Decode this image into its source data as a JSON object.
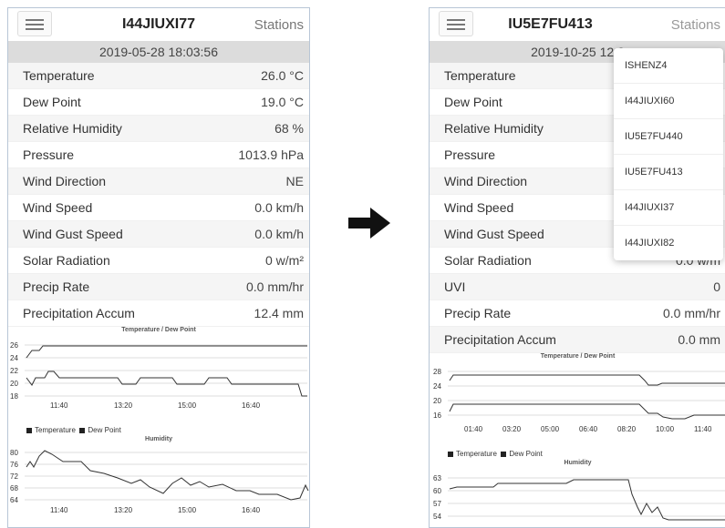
{
  "left": {
    "station_id": "I44JIUXI77",
    "stations_label": "Stations",
    "datetime": "2019-05-28 18:03:56",
    "rows": [
      {
        "label": "Temperature",
        "value": "26.0 °C"
      },
      {
        "label": "Dew Point",
        "value": "19.0 °C"
      },
      {
        "label": "Relative Humidity",
        "value": "68 %"
      },
      {
        "label": "Pressure",
        "value": "1013.9 hPa"
      },
      {
        "label": "Wind Direction",
        "value": "NE"
      },
      {
        "label": "Wind Speed",
        "value": "0.0 km/h"
      },
      {
        "label": "Wind Gust Speed",
        "value": "0.0 km/h"
      },
      {
        "label": "Solar Radiation",
        "value": "0 w/m²"
      },
      {
        "label": "Precip Rate",
        "value": "0.0 mm/hr"
      },
      {
        "label": "Precipitation Accum",
        "value": "12.4 mm"
      }
    ],
    "charts": {
      "temp_title": "Temperature / Dew Point",
      "temp_yticks": [
        "26",
        "24",
        "22",
        "20",
        "18"
      ],
      "temp_xticks": [
        "11:40",
        "13:20",
        "15:00",
        "16:40"
      ],
      "legend_temp": "Temperature",
      "legend_dew": "Dew Point",
      "hum_title": "Humidity",
      "hum_yticks": [
        "80",
        "76",
        "72",
        "68",
        "64"
      ],
      "hum_xticks": [
        "11:40",
        "13:20",
        "15:00",
        "16:40"
      ]
    }
  },
  "right": {
    "station_id": "IU5E7FU413",
    "stations_label": "Stations",
    "datetime": "2019-10-25 12:0",
    "rows": [
      {
        "label": "Temperature",
        "value": ""
      },
      {
        "label": "Dew Point",
        "value": ""
      },
      {
        "label": "Relative Humidity",
        "value": ""
      },
      {
        "label": "Pressure",
        "value": ""
      },
      {
        "label": "Wind Direction",
        "value": ""
      },
      {
        "label": "Wind Speed",
        "value": ""
      },
      {
        "label": "Wind Gust Speed",
        "value": ""
      },
      {
        "label": "Solar Radiation",
        "value": "0.0 w/m"
      },
      {
        "label": "UVI",
        "value": "0"
      },
      {
        "label": "Precip Rate",
        "value": "0.0 mm/hr"
      },
      {
        "label": "Precipitation Accum",
        "value": "0.0 mm"
      }
    ],
    "dropdown": [
      "ISHENZ4",
      "I44JIUXI60",
      "IU5E7FU440",
      "IU5E7FU413",
      "I44JIUXI37",
      "I44JIUXI82"
    ],
    "charts": {
      "temp_title": "Temperature / Dew Point",
      "temp_yticks": [
        "28",
        "24",
        "20",
        "16"
      ],
      "temp_xticks": [
        "01:40",
        "03:20",
        "05:00",
        "06:40",
        "08:20",
        "10:00",
        "11:40"
      ],
      "legend_temp": "Temperature",
      "legend_dew": "Dew Point",
      "hum_title": "Humidity",
      "hum_yticks": [
        "63",
        "60",
        "57",
        "54"
      ]
    }
  },
  "colors": {
    "border": "#b8c6d6",
    "datebar": "#dcdcdc",
    "arrow": "#111111"
  }
}
